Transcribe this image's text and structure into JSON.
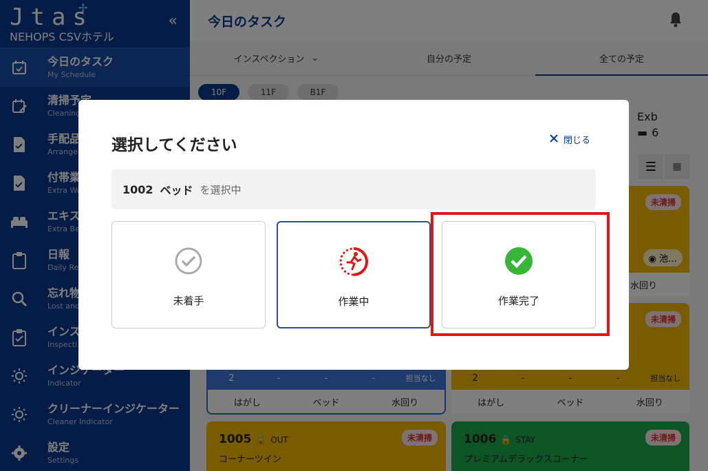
{
  "sidebar": {
    "logo": "Jtas",
    "hotel": "NEHOPS CSVホテル",
    "collapse_icon": "«",
    "items": [
      {
        "jp": "今日のタスク",
        "en": "My Schedule",
        "icon": "calendar-check-icon"
      },
      {
        "jp": "清掃予定",
        "en": "Cleaning",
        "icon": "calendar-edit-icon"
      },
      {
        "jp": "手配品",
        "en": "Arrange",
        "icon": "document-check-icon"
      },
      {
        "jp": "付帯業務",
        "en": "Extra Wo",
        "icon": "document-check-icon"
      },
      {
        "jp": "エキス",
        "en": "Extra Be",
        "icon": "bed-icon"
      },
      {
        "jp": "日報",
        "en": "Daily Re",
        "icon": "clipboard-icon"
      },
      {
        "jp": "忘れ物",
        "en": "Lost and",
        "icon": "search-icon"
      },
      {
        "jp": "インス",
        "en": "Inspecti",
        "icon": "clipboard-check-icon"
      },
      {
        "jp": "インジケーター",
        "en": "Indicator",
        "icon": "sun-icon"
      },
      {
        "jp": "クリーナーインジケーター",
        "en": "Cleaner Indicator",
        "icon": "sun-icon"
      },
      {
        "jp": "設定",
        "en": "Settings",
        "icon": "gear-icon"
      }
    ]
  },
  "header": {
    "title": "今日のタスク"
  },
  "tabs": [
    {
      "label": "インスペクション"
    },
    {
      "label": "自分の予定"
    },
    {
      "label": "全ての予定"
    }
  ],
  "floors": [
    "10F",
    "11F",
    "B1F"
  ],
  "background": {
    "exb_label": "Exb",
    "exb_count": "6",
    "card_badge": "未清掃",
    "row_labels": [
      "はがし",
      "ベッド",
      "水回り"
    ],
    "stat_row_left": [
      "2",
      "-",
      "-",
      "-",
      "担当なし"
    ],
    "stat_row_right": [
      "2",
      "-",
      "-",
      "-",
      "担当なし"
    ],
    "staff_short": "池…",
    "room_1005": "1005",
    "room_1005_status": "OUT",
    "room_1005_type": "コーナーツイン",
    "room_1006": "1006",
    "room_1006_status": "STAY",
    "room_1006_type": "プレミアムデラックスコーナー",
    "mizumawari": "水回り"
  },
  "modal": {
    "title": "選択してください",
    "close_label": "閉じる",
    "selected_room": "1002",
    "selected_item": "ベッド",
    "selected_suffix": "を選択中",
    "options": [
      {
        "label": "未着手",
        "icon": "circle-check-outline-icon"
      },
      {
        "label": "作業中",
        "icon": "running-person-icon"
      },
      {
        "label": "作業完了",
        "icon": "green-check-circle-icon"
      }
    ]
  },
  "colors": {
    "brand": "#0b3a8c",
    "accent_red": "#e01515",
    "done_green": "#36b536",
    "card_yellow": "#f5b800",
    "card_green": "#1fa84a"
  }
}
